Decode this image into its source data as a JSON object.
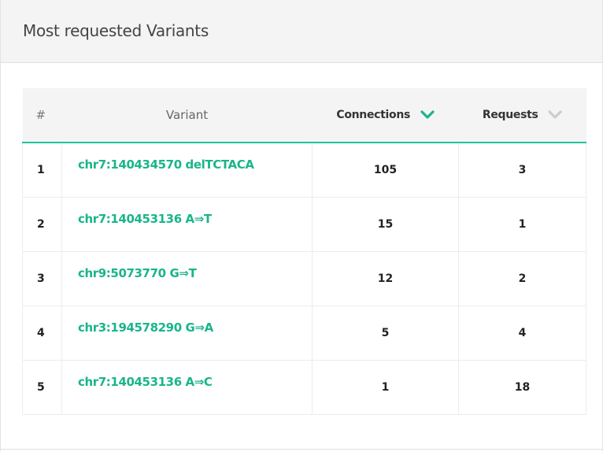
{
  "panel": {
    "title": "Most requested Variants"
  },
  "table": {
    "headers": {
      "rank": "#",
      "variant": "Variant",
      "connections": "Connections",
      "requests": "Requests"
    },
    "sort": {
      "connections": "active",
      "requests": "inactive"
    },
    "rows": [
      {
        "rank": "1",
        "variant": "chr7:140434570 delTCTACA",
        "connections": "105",
        "requests": "3"
      },
      {
        "rank": "2",
        "variant": "chr7:140453136 A⇒T",
        "connections": "15",
        "requests": "1"
      },
      {
        "rank": "3",
        "variant": "chr9:5073770 G⇒T",
        "connections": "12",
        "requests": "2"
      },
      {
        "rank": "4",
        "variant": "chr3:194578290 G⇒A",
        "connections": "5",
        "requests": "4"
      },
      {
        "rank": "5",
        "variant": "chr7:140453136 A⇒C",
        "connections": "1",
        "requests": "18"
      }
    ]
  },
  "colors": {
    "accent": "#1ab58a",
    "sort_active": "#1ab58a",
    "sort_inactive": "#cccccc",
    "header_bg": "#f4f4f4"
  },
  "icons": {
    "sort_connections": "chevron-down-icon",
    "sort_requests": "chevron-down-icon"
  }
}
